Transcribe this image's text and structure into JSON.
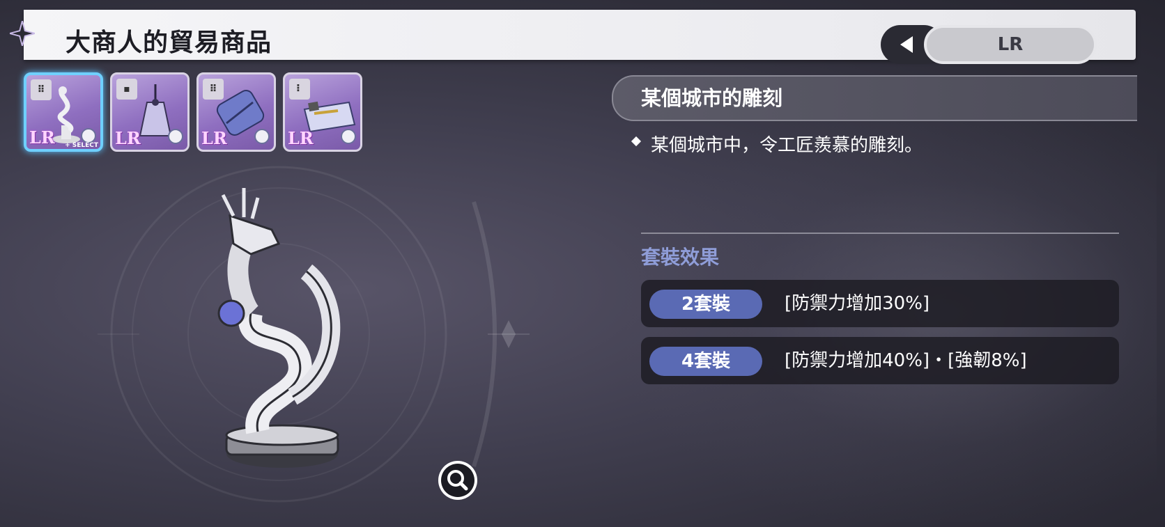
{
  "header": {
    "title": "大商人的貿易商品",
    "rarity_label": "LR"
  },
  "items": [
    {
      "rarity": "LR",
      "selected": true,
      "select_tag": "+ SELECT",
      "slot_icon": "slot-4-icon",
      "art_icon": "dragon-statue-icon"
    },
    {
      "rarity": "LR",
      "selected": false,
      "slot_icon": "slot-1-icon",
      "art_icon": "incense-bottle-icon"
    },
    {
      "rarity": "LR",
      "selected": false,
      "slot_icon": "slot-4-icon",
      "art_icon": "cloth-roll-icon"
    },
    {
      "rarity": "LR",
      "selected": false,
      "slot_icon": "slot-3-icon",
      "art_icon": "document-icon"
    }
  ],
  "detail": {
    "name": "某個城市的雕刻",
    "description": "某個城市中，令工匠羨慕的雕刻。"
  },
  "set_effects": {
    "title": "套裝效果",
    "rows": [
      {
        "pieces": "2套裝",
        "effect": "[防禦力增加30%]"
      },
      {
        "pieces": "4套裝",
        "effect": "[防禦力增加40%]・[強韌8%]"
      }
    ]
  },
  "colors": {
    "accent_blue": "#5a6ab4",
    "set_title": "#8f9dd8",
    "selected_border": "#6fd0ff",
    "item_bg": "#8f6fc0"
  }
}
